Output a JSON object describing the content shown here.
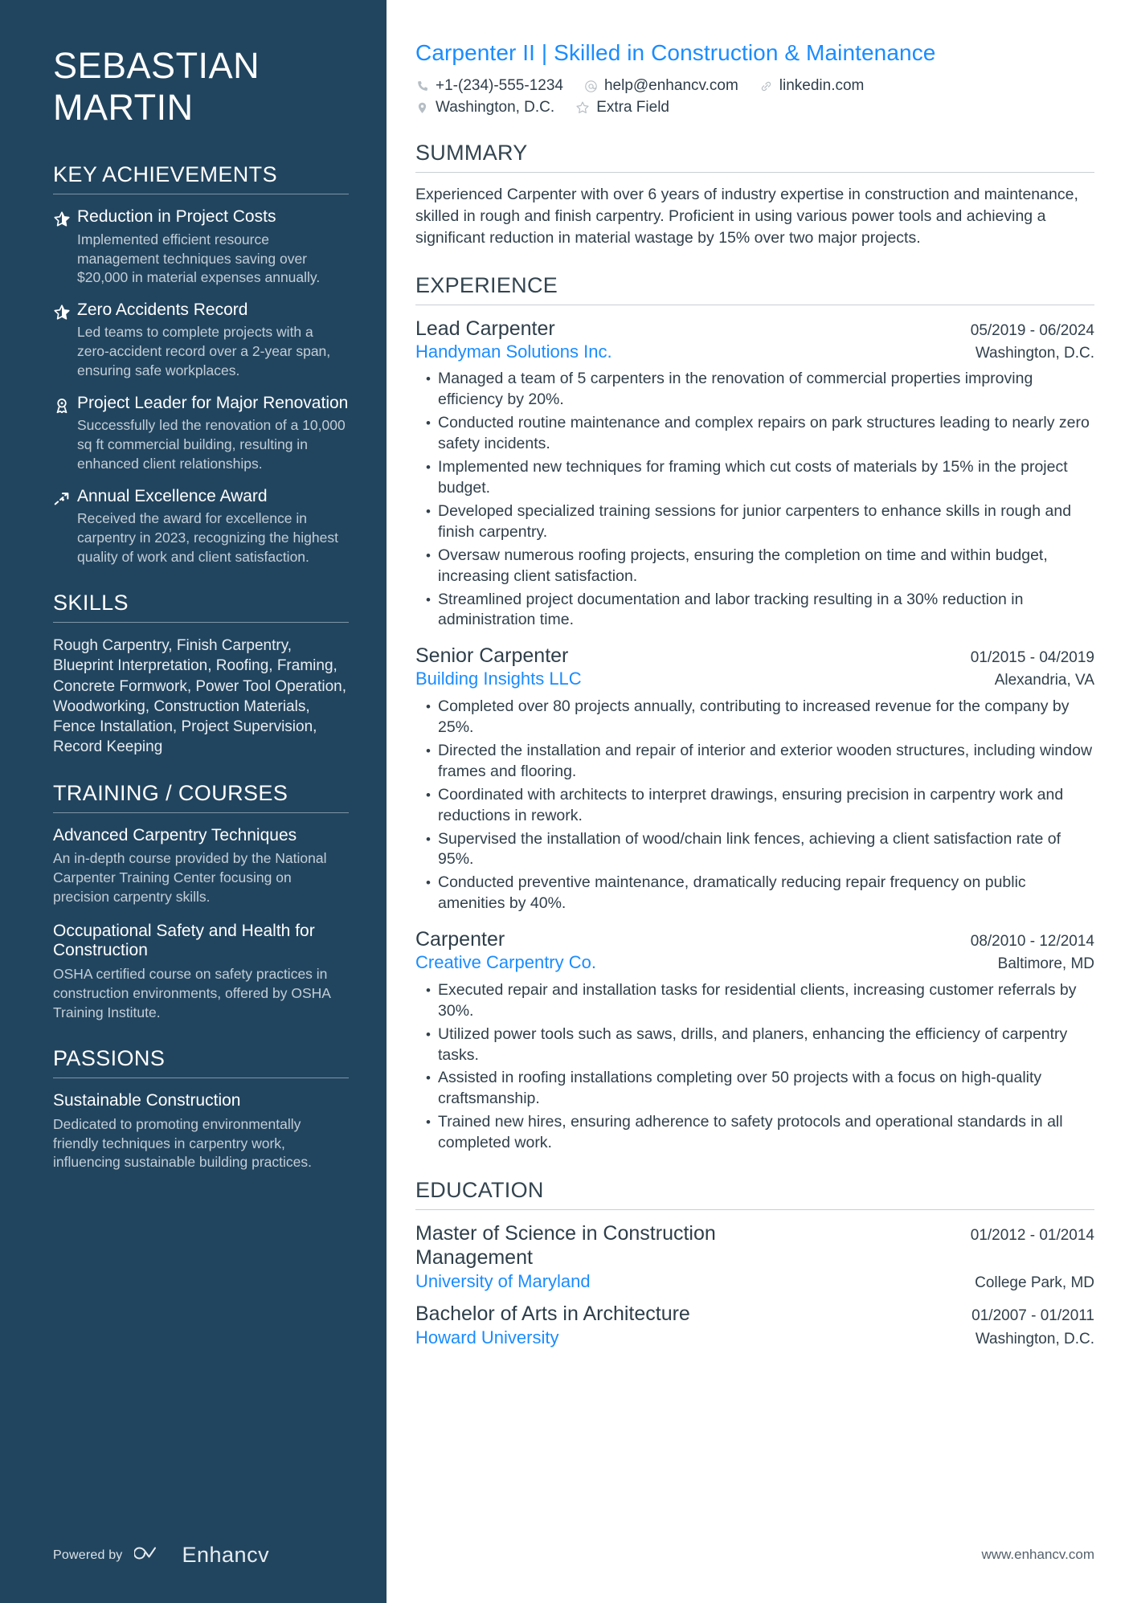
{
  "person": {
    "first_name": "SEBASTIAN",
    "last_name": "MARTIN"
  },
  "header": {
    "headline": "Carpenter II | Skilled in Construction & Maintenance",
    "contacts": [
      {
        "icon": "phone-icon",
        "text": "+1-(234)-555-1234"
      },
      {
        "icon": "email-icon",
        "text": "help@enhancv.com"
      },
      {
        "icon": "link-icon",
        "text": "linkedin.com"
      },
      {
        "icon": "location-icon",
        "text": "Washington, D.C."
      },
      {
        "icon": "star-outline-icon",
        "text": "Extra Field"
      }
    ]
  },
  "sidebar": {
    "achievements": {
      "heading": "KEY ACHIEVEMENTS",
      "items": [
        {
          "icon": "star-half-icon",
          "title": "Reduction in Project Costs",
          "description": "Implemented efficient resource management techniques saving over $20,000 in material expenses annually."
        },
        {
          "icon": "star-half-icon",
          "title": "Zero Accidents Record",
          "description": "Led teams to complete projects with a zero-accident record over a 2-year span, ensuring safe workplaces."
        },
        {
          "icon": "award-ribbon-icon",
          "title": "Project Leader for Major Renovation",
          "description": "Successfully led the renovation of a 10,000 sq ft commercial building, resulting in enhanced client relationships."
        },
        {
          "icon": "trending-arrow-icon",
          "title": "Annual Excellence Award",
          "description": "Received the award for excellence in carpentry in 2023, recognizing the highest quality of work and client satisfaction."
        }
      ]
    },
    "skills": {
      "heading": "SKILLS",
      "text": "Rough Carpentry, Finish Carpentry, Blueprint Interpretation, Roofing, Framing, Concrete Formwork, Power Tool Operation, Woodworking, Construction Materials, Fence Installation, Project Supervision, Record Keeping"
    },
    "training": {
      "heading": "TRAINING / COURSES",
      "items": [
        {
          "title": "Advanced Carpentry Techniques",
          "description": "An in-depth course provided by the National Carpenter Training Center focusing on precision carpentry skills."
        },
        {
          "title": "Occupational Safety and Health for Construction",
          "description": "OSHA certified course on safety practices in construction environments, offered by OSHA Training Institute."
        }
      ]
    },
    "passions": {
      "heading": "PASSIONS",
      "items": [
        {
          "title": "Sustainable Construction",
          "description": "Dedicated to promoting environmentally friendly techniques in carpentry work, influencing sustainable building practices."
        }
      ]
    },
    "footer": {
      "powered_by": "Powered by",
      "brand": "Enhancv"
    }
  },
  "main": {
    "summary": {
      "heading": "SUMMARY",
      "text": "Experienced Carpenter with over 6 years of industry expertise in construction and maintenance, skilled in rough and finish carpentry. Proficient in using various power tools and achieving a significant reduction in material wastage by 15% over two major projects."
    },
    "experience": {
      "heading": "EXPERIENCE",
      "jobs": [
        {
          "title": "Lead Carpenter",
          "date": "05/2019 - 06/2024",
          "company": "Handyman Solutions Inc.",
          "location": "Washington, D.C.",
          "bullets": [
            "Managed a team of 5 carpenters in the renovation of commercial properties improving efficiency by 20%.",
            "Conducted routine maintenance and complex repairs on park structures leading to nearly zero safety incidents.",
            "Implemented new techniques for framing which cut costs of materials by 15% in the project budget.",
            "Developed specialized training sessions for junior carpenters to enhance skills in rough and finish carpentry.",
            "Oversaw numerous roofing projects, ensuring the completion on time and within budget, increasing client satisfaction.",
            "Streamlined project documentation and labor tracking resulting in a 30% reduction in administration time."
          ]
        },
        {
          "title": "Senior Carpenter",
          "date": "01/2015 - 04/2019",
          "company": "Building Insights LLC",
          "location": "Alexandria, VA",
          "bullets": [
            "Completed over 80 projects annually, contributing to increased revenue for the company by 25%.",
            "Directed the installation and repair of interior and exterior wooden structures, including window frames and flooring.",
            "Coordinated with architects to interpret drawings, ensuring precision in carpentry work and reductions in rework.",
            "Supervised the installation of wood/chain link fences, achieving a client satisfaction rate of 95%.",
            "Conducted preventive maintenance, dramatically reducing repair frequency on public amenities by 40%."
          ]
        },
        {
          "title": "Carpenter",
          "date": "08/2010 - 12/2014",
          "company": "Creative Carpentry Co.",
          "location": "Baltimore, MD",
          "bullets": [
            "Executed repair and installation tasks for residential clients, increasing customer referrals by 30%.",
            "Utilized power tools such as saws, drills, and planers, enhancing the efficiency of carpentry tasks.",
            "Assisted in roofing installations completing over 50 projects with a focus on high-quality craftsmanship.",
            "Trained new hires, ensuring adherence to safety protocols and operational standards in all completed work."
          ]
        }
      ]
    },
    "education": {
      "heading": "EDUCATION",
      "items": [
        {
          "degree": "Master of Science in Construction Management",
          "date": "01/2012 - 01/2014",
          "school": "University of Maryland",
          "location": "College Park, MD"
        },
        {
          "degree": "Bachelor of Arts in Architecture",
          "date": "01/2007 - 01/2011",
          "school": "Howard University",
          "location": "Washington, D.C."
        }
      ]
    },
    "site_url": "www.enhancv.com"
  },
  "colors": {
    "sidebar_bg": "#22455f",
    "accent_blue": "#1a8cff",
    "body_text": "#31404b"
  }
}
